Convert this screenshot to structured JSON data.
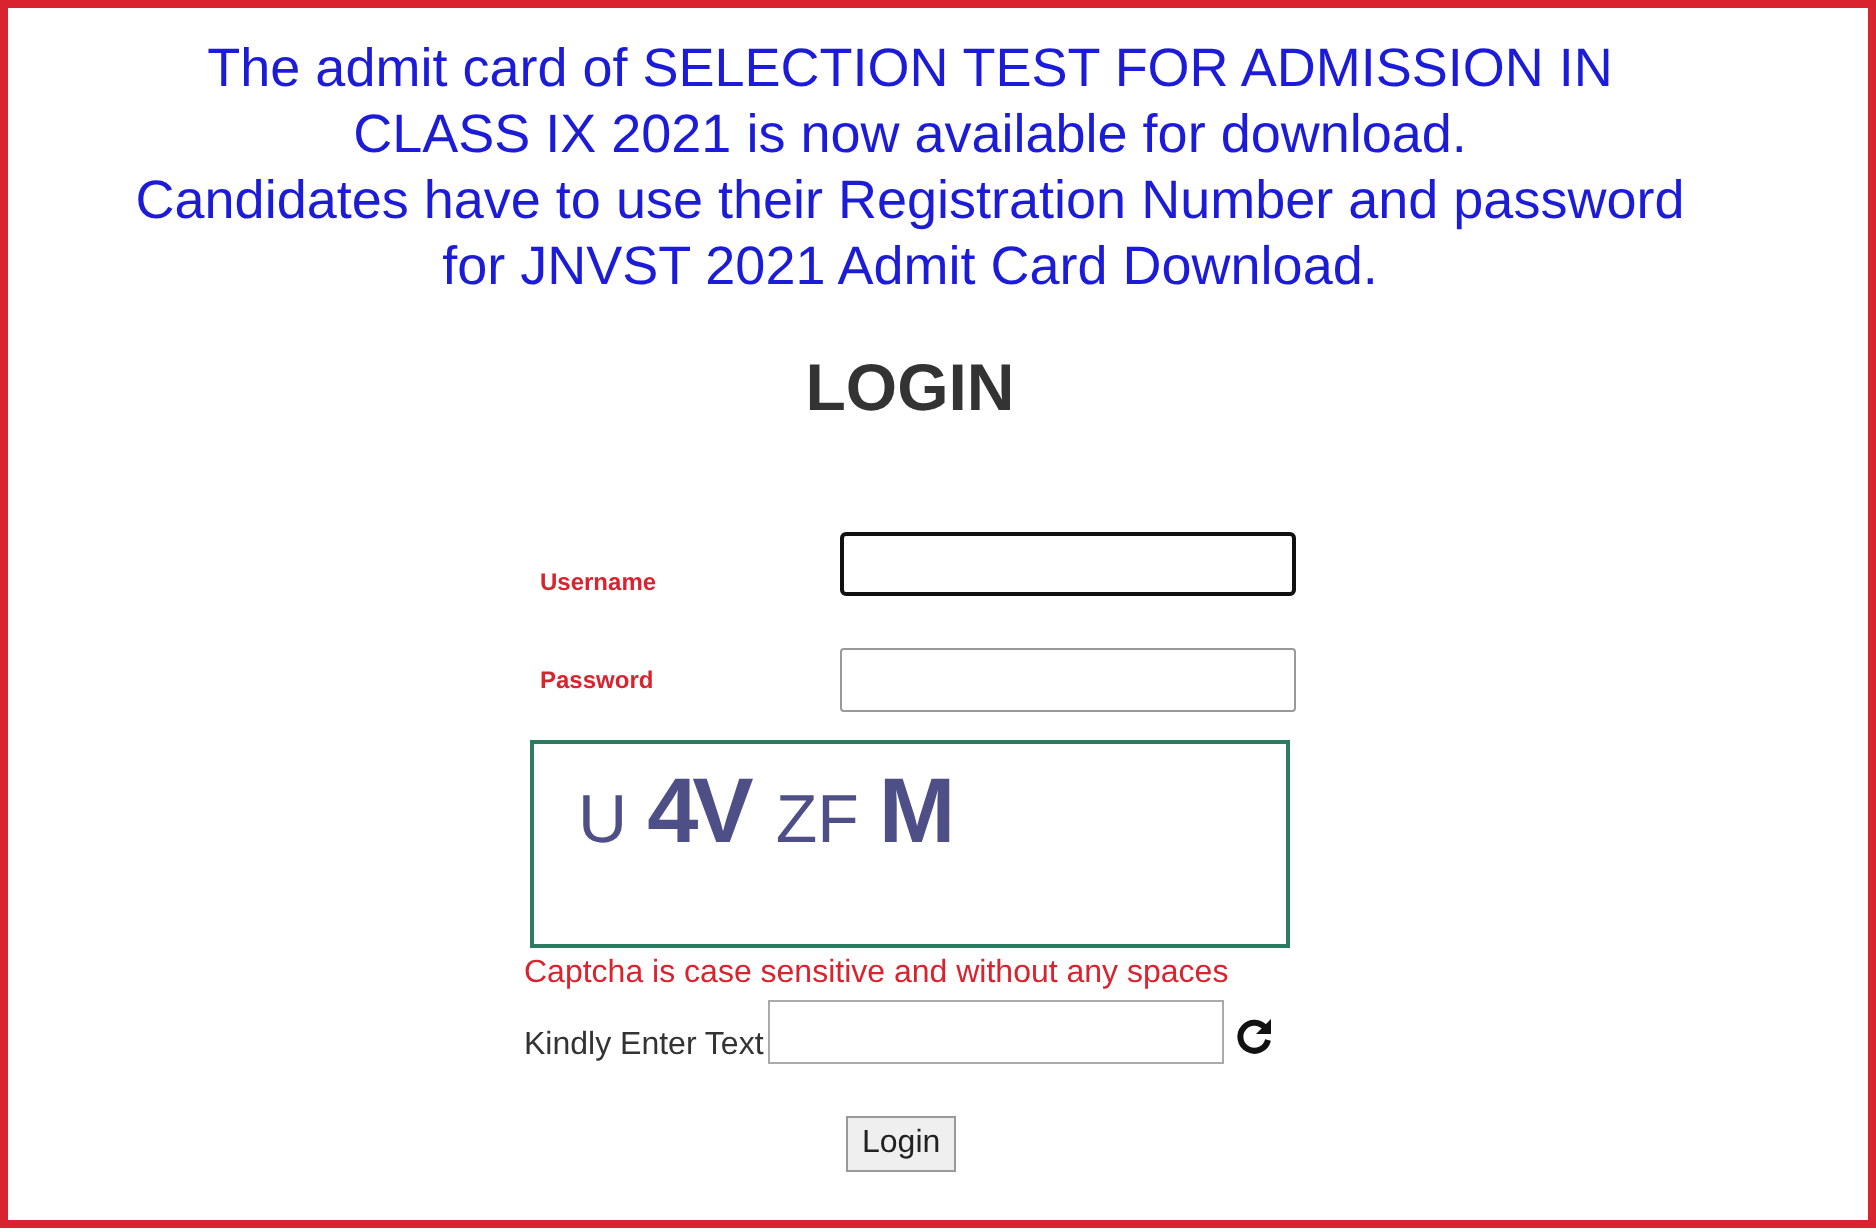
{
  "notice_lines": [
    "The admit card of SELECTION TEST FOR ADMISSION IN",
    "CLASS IX 2021 is now available for download.",
    "Candidates have to use their Registration Number and password",
    "for JNVST 2021 Admit Card Download."
  ],
  "heading": "LOGIN",
  "fields": [
    {
      "label": "Username",
      "focused": true
    },
    {
      "label": "Password",
      "focused": false
    }
  ],
  "captcha": {
    "chars": [
      {
        "text": "U",
        "bold": false
      },
      {
        "text": "4V",
        "bold": true
      },
      {
        "text": "ZF",
        "bold": false
      },
      {
        "text": "M",
        "bold": true
      }
    ],
    "note": "Captcha is case sensitive and without any spaces",
    "input_label": "Kindly Enter Text"
  },
  "button": "Login"
}
